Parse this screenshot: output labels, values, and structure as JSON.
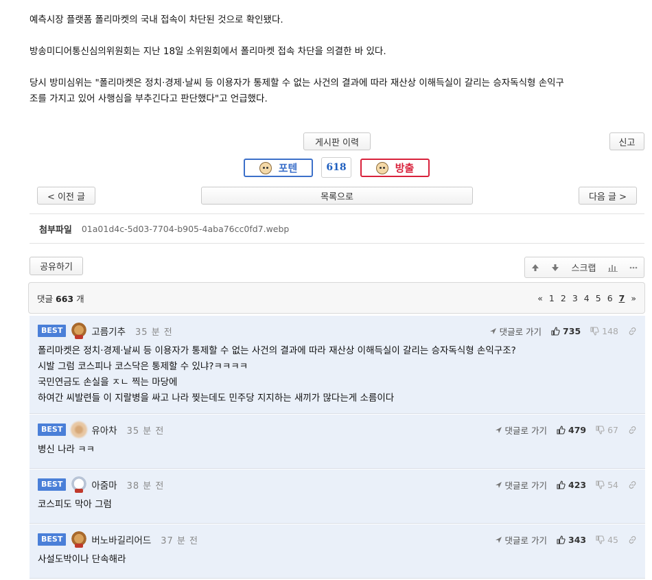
{
  "article": {
    "lines": [
      "예측시장 플랫폼 폴리마켓의 국내 접속이 차단된 것으로 확인됐다.",
      "방송미디어통신심의위원회는 지난 18일 소위원회에서 폴리마켓 접속 차단을 의결한 바 있다.",
      "당시 방미심위는 \"폴리마켓은 정치·경제·날씨 등 이용자가 통제할 수 없는 사건의 결과에 따라 재산상 이해득실이 갈리는 승자독식형 손익구",
      "조를 가지고 있어 사행심을 부추긴다고 판단했다\"고 언급했다."
    ]
  },
  "buttons": {
    "history": "게시판 이력",
    "report": "신고",
    "prev": "< 이전 글",
    "list": "목록으로",
    "next": "다음 글 >",
    "share": "공유하기"
  },
  "vote": {
    "up_label": "포텐",
    "score": "618",
    "down_label": "방출",
    "up_color": "#3b6fc9",
    "down_color": "#d8203a"
  },
  "attachment": {
    "label": "첨부파일",
    "filename": "01a01d4c-5d03-7704-b905-4aba76cc0fd7.webp"
  },
  "toolbar": {
    "scrap": "스크랩"
  },
  "comments_header": {
    "prefix": "댓글",
    "count": "663",
    "suffix": "개",
    "pages": [
      "«",
      "1",
      "2",
      "3",
      "4",
      "5",
      "6",
      "7",
      "»"
    ],
    "current_page": "7"
  },
  "comments": [
    {
      "badge": "BEST",
      "avatar": "dog-icon",
      "nick": "고름기추",
      "time": "35 분 전",
      "reply": "댓글로 가기",
      "up": "735",
      "down": "148",
      "body": [
        "폴리마켓은 정치·경제·날씨 등 이용자가 통제할 수 없는 사건의 결과에 따라 재산상 이해득실이 갈리는 승자독식형 손익구조?",
        "시발 그럼 코스피나 코스닥은 통제할 수 있냐?ㅋㅋㅋㅋ",
        "국민연금도 손실을 ㅈㄴ 찍는 마당에",
        "하여간 씨발련들 이 지랄병을 싸고 나라 찢는데도 민주당 지지하는 새끼가 많다는게 소름이다"
      ]
    },
    {
      "badge": "BEST",
      "avatar": "blurred-avatar-icon",
      "nick": "유아차",
      "time": "35 분 전",
      "reply": "댓글로 가기",
      "up": "479",
      "down": "67",
      "body": [
        "병신 나라 ㅋㅋ"
      ]
    },
    {
      "badge": "BEST",
      "avatar": "white-dog-icon",
      "nick": "아줌마",
      "time": "38 분 전",
      "reply": "댓글로 가기",
      "up": "423",
      "down": "54",
      "body": [
        "코스피도 막아 그럼"
      ]
    },
    {
      "badge": "BEST",
      "avatar": "dog-icon",
      "nick": "버노바길리어드",
      "time": "37 분 전",
      "reply": "댓글로 가기",
      "up": "343",
      "down": "45",
      "body": [
        "사설도박이나 단속해라"
      ]
    }
  ]
}
